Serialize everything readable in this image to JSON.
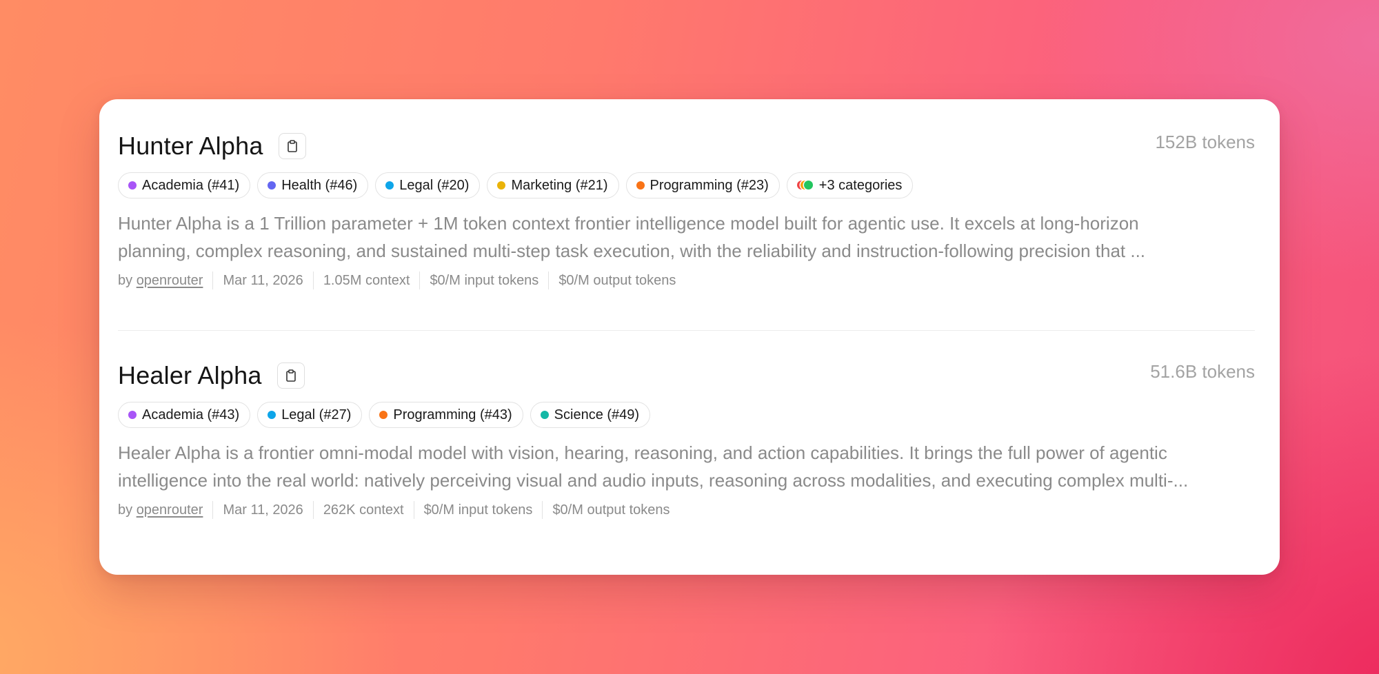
{
  "models": [
    {
      "name": "Hunter Alpha",
      "tokens": "152B tokens",
      "tags": [
        {
          "label": "Academia (#41)",
          "color": "#a855f7"
        },
        {
          "label": "Health (#46)",
          "color": "#6366f1"
        },
        {
          "label": "Legal (#20)",
          "color": "#0ea5e9"
        },
        {
          "label": "Marketing (#21)",
          "color": "#eab308"
        },
        {
          "label": "Programming (#23)",
          "color": "#f97316"
        }
      ],
      "more_categories": {
        "label": "+3 categories",
        "colors": [
          "#ef4444",
          "#f59e0b",
          "#22c55e"
        ]
      },
      "description_line1": "Hunter Alpha is a 1 Trillion parameter + 1M token context frontier intelligence model built for agentic use. It excels at long-horizon",
      "description_line2": "planning, complex reasoning, and sustained multi-step task execution, with the reliability and instruction-following precision that ...",
      "by": "by",
      "author": "openrouter",
      "date": "Mar 11, 2026",
      "context": "1.05M context",
      "input_price": "$0/M input tokens",
      "output_price": "$0/M output tokens"
    },
    {
      "name": "Healer Alpha",
      "tokens": "51.6B tokens",
      "tags": [
        {
          "label": "Academia (#43)",
          "color": "#a855f7"
        },
        {
          "label": "Legal (#27)",
          "color": "#0ea5e9"
        },
        {
          "label": "Programming (#43)",
          "color": "#f97316"
        },
        {
          "label": "Science (#49)",
          "color": "#14b8a6"
        }
      ],
      "description_line1": "Healer Alpha is a frontier omni-modal model with vision, hearing, reasoning, and action capabilities. It brings the full power of agentic",
      "description_line2": "intelligence into the real world: natively perceiving visual and audio inputs, reasoning across modalities, and executing complex multi-...",
      "by": "by",
      "author": "openrouter",
      "date": "Mar 11, 2026",
      "context": "262K context",
      "input_price": "$0/M input tokens",
      "output_price": "$0/M output tokens"
    }
  ]
}
